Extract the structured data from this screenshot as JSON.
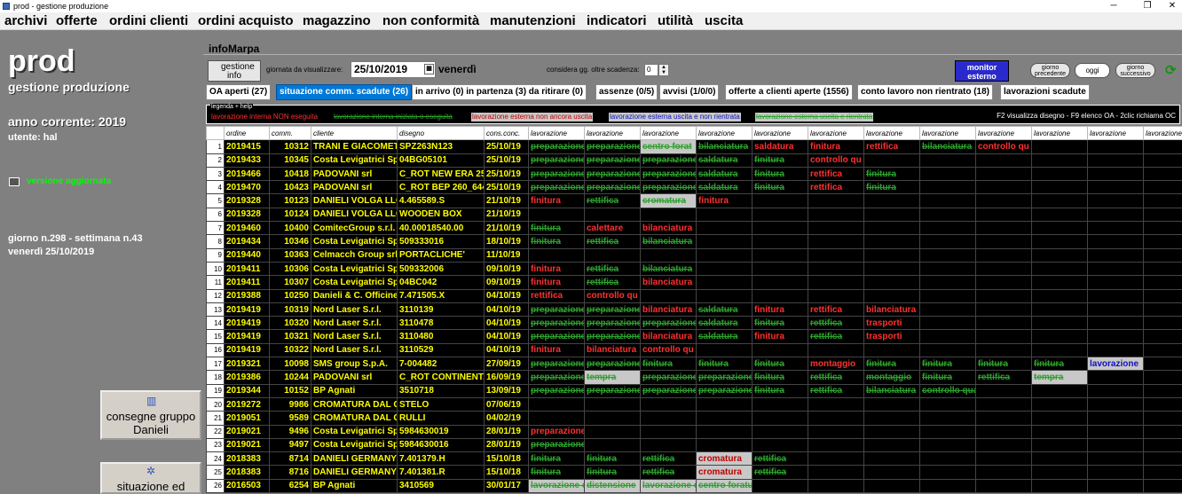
{
  "window": {
    "title": "prod - gestione produzione",
    "controls": [
      "─",
      "❐",
      "✕"
    ]
  },
  "menu": [
    "archivi",
    "offerte",
    "ordini clienti",
    "ordini acquisto",
    "magazzino",
    "non conformità",
    "manutenzioni",
    "indicatori",
    "utilità",
    "uscita"
  ],
  "left": {
    "app_name": "prod",
    "subtitle": "gestione produzione",
    "year": "anno corrente: 2019",
    "user": "utente: hal",
    "version": "versione aggiornata",
    "day": "giorno n.298 - settimana n.43",
    "date": "venerdì 25/10/2019",
    "btn_consegne": "consegne gruppo Danieli",
    "btn_situazione": "situazione ed"
  },
  "main": {
    "section_title": "infoMarpa",
    "gestione_label": "gestione info",
    "giorno_label": "giornata da visualizzare:",
    "giorno_value": "25/10/2019",
    "weekday": "venerdì",
    "considera_label": "considera gg. oltre scadenza:",
    "considera_value": "0",
    "monitor_label": "monitor esterno",
    "prev_label": "giorno precedente",
    "oggi_label": "oggi",
    "next_label": "giorno successivo",
    "tabs": [
      "OA aperti (27)",
      "situazione comm. scadute (26)",
      "in arrivo (0) in partenza (3) da ritirare (0)",
      "assenze (0/5)",
      "avvisi (1/0/0)",
      "offerte a clienti aperte (1556)",
      "conto lavoro non rientrato (18)",
      "lavorazioni scadute"
    ],
    "legend_title": "legenda + help",
    "legend": [
      {
        "text": "lavorazione interna NON eseguita",
        "kind": "internal-not-done"
      },
      {
        "text": "lavorazione interna iniziata o eseguita",
        "kind": "internal-started"
      },
      {
        "text": "lavorazione esterna non ancora uscita",
        "kind": "external-not-sent"
      },
      {
        "text": "lavorazione esterna uscita e non rientrata",
        "kind": "external-out-not-back"
      },
      {
        "text": "lavorazione esterna uscita e rientrata",
        "kind": "external-back"
      }
    ],
    "help_text": "F2 visualizza disegno - F9 elenco OA - 2clic richiama OC",
    "colors": {
      "accent": "#0078d7",
      "grid_bg": "#000000",
      "yellow": "#ffff00",
      "red": "#ff3030",
      "green": "#2ea02e",
      "blue": "#1010c0"
    }
  },
  "table": {
    "columns": [
      "",
      "ordine",
      "comm.",
      "cliente",
      "disegno",
      "cons.conc.",
      "lavorazione",
      "lavorazione",
      "lavorazione",
      "lavorazione",
      "lavorazione",
      "lavorazione",
      "lavorazione",
      "lavorazione",
      "lavorazione",
      "lavorazione",
      "lavorazione",
      "lavorazione"
    ],
    "rows": [
      {
        "n": "1",
        "ordine": "2019415",
        "comm": "10312",
        "cliente": "TRANI E GIACOMET",
        "disegno": "SPZ263N123",
        "cons": "25/10/19",
        "ops": [
          [
            "preparazione",
            "g"
          ],
          [
            "preparazione",
            "g"
          ],
          [
            "centro forat",
            "G"
          ],
          [
            "bilanciatura",
            "g"
          ],
          [
            "saldatura",
            "r"
          ],
          [
            "finitura",
            "r"
          ],
          [
            "rettifica",
            "r"
          ],
          [
            "bilanciatura",
            "g"
          ],
          [
            "controllo qu",
            "r"
          ]
        ]
      },
      {
        "n": "2",
        "ordine": "2019433",
        "comm": "10345",
        "cliente": "Costa Levigatrici Sp",
        "disegno": "04BG05101",
        "cons": "25/10/19",
        "ops": [
          [
            "preparazione",
            "g"
          ],
          [
            "preparazione",
            "g"
          ],
          [
            "preparazione",
            "g"
          ],
          [
            "saldatura",
            "g"
          ],
          [
            "finitura",
            "g"
          ],
          [
            "controllo qu",
            "r"
          ]
        ]
      },
      {
        "n": "3",
        "ordine": "2019466",
        "comm": "10418",
        "cliente": "PADOVANI srl",
        "disegno": "C_ROT NEW ERA 25",
        "cons": "25/10/19",
        "ops": [
          [
            "preparazione",
            "g"
          ],
          [
            "preparazione",
            "g"
          ],
          [
            "preparazione",
            "g"
          ],
          [
            "saldatura",
            "g"
          ],
          [
            "finitura",
            "g"
          ],
          [
            "rettifica",
            "r"
          ],
          [
            "finitura",
            "g"
          ]
        ]
      },
      {
        "n": "4",
        "ordine": "2019470",
        "comm": "10423",
        "cliente": "PADOVANI srl",
        "disegno": "C_ROT BEP 260_644",
        "cons": "25/10/19",
        "ops": [
          [
            "preparazione",
            "g"
          ],
          [
            "preparazione",
            "g"
          ],
          [
            "preparazione",
            "g"
          ],
          [
            "saldatura",
            "g"
          ],
          [
            "finitura",
            "g"
          ],
          [
            "rettifica",
            "r"
          ],
          [
            "finitura",
            "g"
          ]
        ]
      },
      {
        "n": "5",
        "ordine": "2019328",
        "comm": "10123",
        "cliente": "DANIELI VOLGA LLC",
        "disegno": "4.465589.S",
        "cons": "21/10/19",
        "ops": [
          [
            "finitura",
            "r"
          ],
          [
            "rettifica",
            "g"
          ],
          [
            "cromatura",
            "G"
          ],
          [
            "finitura",
            "r"
          ]
        ]
      },
      {
        "n": "6",
        "ordine": "2019328",
        "comm": "10124",
        "cliente": "DANIELI VOLGA LLC",
        "disegno": "WOODEN BOX",
        "cons": "21/10/19",
        "ops": []
      },
      {
        "n": "7",
        "ordine": "2019460",
        "comm": "10400",
        "cliente": "ComitecGroup s.r.l.",
        "disegno": "40.00018540.00",
        "cons": "21/10/19",
        "ops": [
          [
            "finitura",
            "g"
          ],
          [
            "calettare",
            "r"
          ],
          [
            "bilanciatura",
            "r"
          ]
        ]
      },
      {
        "n": "8",
        "ordine": "2019434",
        "comm": "10346",
        "cliente": "Costa Levigatrici Sp",
        "disegno": "509333016",
        "cons": "18/10/19",
        "ops": [
          [
            "finitura",
            "g"
          ],
          [
            "rettifica",
            "g"
          ],
          [
            "bilanciatura",
            "g"
          ]
        ]
      },
      {
        "n": "9",
        "ordine": "2019440",
        "comm": "10363",
        "cliente": "Celmacch Group srl",
        "disegno": "PORTACLICHE'",
        "cons": "11/10/19",
        "ops": []
      },
      {
        "n": "10",
        "ordine": "2019411",
        "comm": "10306",
        "cliente": "Costa Levigatrici Sp",
        "disegno": "509332006",
        "cons": "09/10/19",
        "ops": [
          [
            "finitura",
            "r"
          ],
          [
            "rettifica",
            "g"
          ],
          [
            "bilanciatura",
            "g"
          ]
        ]
      },
      {
        "n": "11",
        "ordine": "2019411",
        "comm": "10307",
        "cliente": "Costa Levigatrici Sp",
        "disegno": "04BC042",
        "cons": "09/10/19",
        "ops": [
          [
            "finitura",
            "r"
          ],
          [
            "rettifica",
            "g"
          ],
          [
            "bilanciatura",
            "r"
          ]
        ]
      },
      {
        "n": "12",
        "ordine": "2019388",
        "comm": "10250",
        "cliente": "Danieli & C. Officine",
        "disegno": "7.471505.X",
        "cons": "04/10/19",
        "ops": [
          [
            "rettifica",
            "r"
          ],
          [
            "controllo qu",
            "r"
          ]
        ]
      },
      {
        "n": "13",
        "ordine": "2019419",
        "comm": "10319",
        "cliente": "Nord Laser S.r.l.",
        "disegno": "3110139",
        "cons": "04/10/19",
        "ops": [
          [
            "preparazione",
            "g"
          ],
          [
            "preparazione",
            "g"
          ],
          [
            "bilanciatura",
            "r"
          ],
          [
            "saldatura",
            "g"
          ],
          [
            "finitura",
            "r"
          ],
          [
            "rettifica",
            "r"
          ],
          [
            "bilanciatura",
            "r"
          ]
        ]
      },
      {
        "n": "14",
        "ordine": "2019419",
        "comm": "10320",
        "cliente": "Nord Laser S.r.l.",
        "disegno": "3110478",
        "cons": "04/10/19",
        "ops": [
          [
            "preparazione",
            "g"
          ],
          [
            "preparazione",
            "g"
          ],
          [
            "preparazione",
            "g"
          ],
          [
            "saldatura",
            "g"
          ],
          [
            "finitura",
            "g"
          ],
          [
            "rettifica",
            "g"
          ],
          [
            "trasporti",
            "r"
          ]
        ]
      },
      {
        "n": "15",
        "ordine": "2019419",
        "comm": "10321",
        "cliente": "Nord Laser S.r.l.",
        "disegno": "3110480",
        "cons": "04/10/19",
        "ops": [
          [
            "preparazione",
            "g"
          ],
          [
            "preparazione",
            "g"
          ],
          [
            "bilanciatura",
            "r"
          ],
          [
            "saldatura",
            "g"
          ],
          [
            "finitura",
            "r"
          ],
          [
            "rettifica",
            "g"
          ],
          [
            "trasporti",
            "r"
          ]
        ]
      },
      {
        "n": "16",
        "ordine": "2019419",
        "comm": "10322",
        "cliente": "Nord Laser S.r.l.",
        "disegno": "3110529",
        "cons": "04/10/19",
        "ops": [
          [
            "finitura",
            "r"
          ],
          [
            "bilanciatura",
            "r"
          ],
          [
            "controllo qu",
            "r"
          ]
        ]
      },
      {
        "n": "17",
        "ordine": "2019321",
        "comm": "10098",
        "cliente": "SMS group S.p.A.",
        "disegno": "7-004482",
        "cons": "27/09/19",
        "ops": [
          [
            "preparazione",
            "g"
          ],
          [
            "preparazione",
            "g"
          ],
          [
            "finitura",
            "g"
          ],
          [
            "finitura",
            "g"
          ],
          [
            "finitura",
            "g"
          ],
          [
            "montaggio",
            "r"
          ],
          [
            "finitura",
            "g"
          ],
          [
            "finitura",
            "g"
          ],
          [
            "finitura",
            "g"
          ],
          [
            "finitura",
            "g"
          ],
          [
            "lavorazione",
            "b"
          ]
        ]
      },
      {
        "n": "18",
        "ordine": "2019386",
        "comm": "10244",
        "cliente": "PADOVANI srl",
        "disegno": "C_ROT CONTINENTA",
        "cons": "16/09/19",
        "ops": [
          [
            "preparazione",
            "g"
          ],
          [
            "tempra",
            "G"
          ],
          [
            "preparazione",
            "g"
          ],
          [
            "preparazione",
            "g"
          ],
          [
            "finitura",
            "g"
          ],
          [
            "rettifica",
            "g"
          ],
          [
            "montaggio",
            "g"
          ],
          [
            "finitura",
            "g"
          ],
          [
            "rettifica",
            "g"
          ],
          [
            "tempra",
            "G"
          ]
        ]
      },
      {
        "n": "19",
        "ordine": "2019344",
        "comm": "10152",
        "cliente": "BP Agnati",
        "disegno": "3510718",
        "cons": "13/09/19",
        "ops": [
          [
            "preparazione",
            "g"
          ],
          [
            "preparazione",
            "g"
          ],
          [
            "preparazione",
            "g"
          ],
          [
            "preparazione",
            "g"
          ],
          [
            "finitura",
            "g"
          ],
          [
            "rettifica",
            "g"
          ],
          [
            "bilanciatura",
            "g"
          ],
          [
            "controllo qua",
            "g"
          ]
        ]
      },
      {
        "n": "20",
        "ordine": "2019272",
        "comm": "9986",
        "cliente": "CROMATURA DAL G",
        "disegno": "STELO",
        "cons": "07/06/19",
        "ops": []
      },
      {
        "n": "21",
        "ordine": "2019051",
        "comm": "9589",
        "cliente": "CROMATURA DAL G",
        "disegno": "RULLI",
        "cons": "04/02/19",
        "ops": []
      },
      {
        "n": "22",
        "ordine": "2019021",
        "comm": "9496",
        "cliente": "Costa Levigatrici Sp",
        "disegno": "5984630019",
        "cons": "28/01/19",
        "ops": [
          [
            "preparazione",
            "r"
          ]
        ]
      },
      {
        "n": "23",
        "ordine": "2019021",
        "comm": "9497",
        "cliente": "Costa Levigatrici Sp",
        "disegno": "5984630016",
        "cons": "28/01/19",
        "ops": [
          [
            "preparazione",
            "g"
          ]
        ]
      },
      {
        "n": "24",
        "ordine": "2018383",
        "comm": "8714",
        "cliente": "DANIELI GERMANY",
        "disegno": "7.401379.H",
        "cons": "15/10/18",
        "ops": [
          [
            "finitura",
            "g"
          ],
          [
            "finitura",
            "g"
          ],
          [
            "rettifica",
            "g"
          ],
          [
            "cromatura",
            "R"
          ],
          [
            "rettifica",
            "g"
          ]
        ]
      },
      {
        "n": "25",
        "ordine": "2018383",
        "comm": "8716",
        "cliente": "DANIELI GERMANY",
        "disegno": "7.401381.R",
        "cons": "15/10/18",
        "ops": [
          [
            "finitura",
            "g"
          ],
          [
            "finitura",
            "g"
          ],
          [
            "rettifica",
            "g"
          ],
          [
            "cromatura",
            "R"
          ],
          [
            "rettifica",
            "g"
          ]
        ]
      },
      {
        "n": "26",
        "ordine": "2016503",
        "comm": "6254",
        "cliente": "BP Agnati",
        "disegno": "3410569",
        "cons": "30/01/17",
        "ops": [
          [
            "lavorazione e",
            "G"
          ],
          [
            "distensione",
            "G"
          ],
          [
            "lavorazione e",
            "G"
          ],
          [
            "centro foratu",
            "G"
          ]
        ]
      }
    ]
  }
}
